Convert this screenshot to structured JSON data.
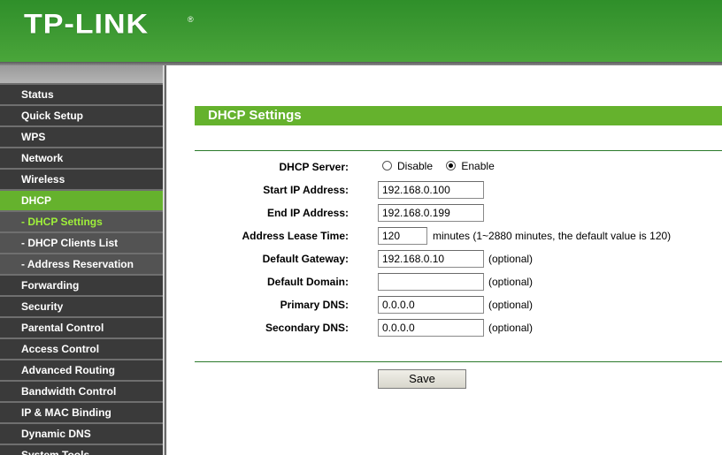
{
  "brand": {
    "logo_text": "TP-LINK",
    "registered_mark": "®",
    "color_header": "#3e9a33",
    "color_accent": "#65b22d"
  },
  "sidebar": {
    "items": [
      {
        "label": "Status",
        "type": "main",
        "state": "normal"
      },
      {
        "label": "Quick Setup",
        "type": "main",
        "state": "normal"
      },
      {
        "label": "WPS",
        "type": "main",
        "state": "normal"
      },
      {
        "label": "Network",
        "type": "main",
        "state": "normal"
      },
      {
        "label": "Wireless",
        "type": "main",
        "state": "normal"
      },
      {
        "label": "DHCP",
        "type": "main",
        "state": "active"
      },
      {
        "label": "- DHCP Settings",
        "type": "sub",
        "state": "active"
      },
      {
        "label": "- DHCP Clients List",
        "type": "sub",
        "state": "normal"
      },
      {
        "label": "- Address Reservation",
        "type": "sub",
        "state": "normal"
      },
      {
        "label": "Forwarding",
        "type": "main",
        "state": "normal"
      },
      {
        "label": "Security",
        "type": "main",
        "state": "normal"
      },
      {
        "label": "Parental Control",
        "type": "main",
        "state": "normal"
      },
      {
        "label": "Access Control",
        "type": "main",
        "state": "normal"
      },
      {
        "label": "Advanced Routing",
        "type": "main",
        "state": "normal"
      },
      {
        "label": "Bandwidth Control",
        "type": "main",
        "state": "normal"
      },
      {
        "label": "IP & MAC Binding",
        "type": "main",
        "state": "normal"
      },
      {
        "label": "Dynamic DNS",
        "type": "main",
        "state": "normal"
      },
      {
        "label": "System Tools",
        "type": "main",
        "state": "normal"
      }
    ]
  },
  "main": {
    "title": "DHCP Settings",
    "dhcp_server": {
      "label": "DHCP Server:",
      "options": [
        "Disable",
        "Enable"
      ],
      "selected": "Enable"
    },
    "start_ip": {
      "label": "Start IP Address:",
      "value": "192.168.0.100"
    },
    "end_ip": {
      "label": "End IP Address:",
      "value": "192.168.0.199"
    },
    "lease_time": {
      "label": "Address Lease Time:",
      "value": "120",
      "note": "minutes (1~2880 minutes, the default value is 120)"
    },
    "gateway": {
      "label": "Default Gateway:",
      "value": "192.168.0.10",
      "note": "(optional)"
    },
    "domain": {
      "label": "Default Domain:",
      "value": "",
      "note": "(optional)"
    },
    "primary_dns": {
      "label": "Primary DNS:",
      "value": "0.0.0.0",
      "note": "(optional)"
    },
    "secondary_dns": {
      "label": "Secondary DNS:",
      "value": "0.0.0.0",
      "note": "(optional)"
    },
    "save_label": "Save"
  }
}
